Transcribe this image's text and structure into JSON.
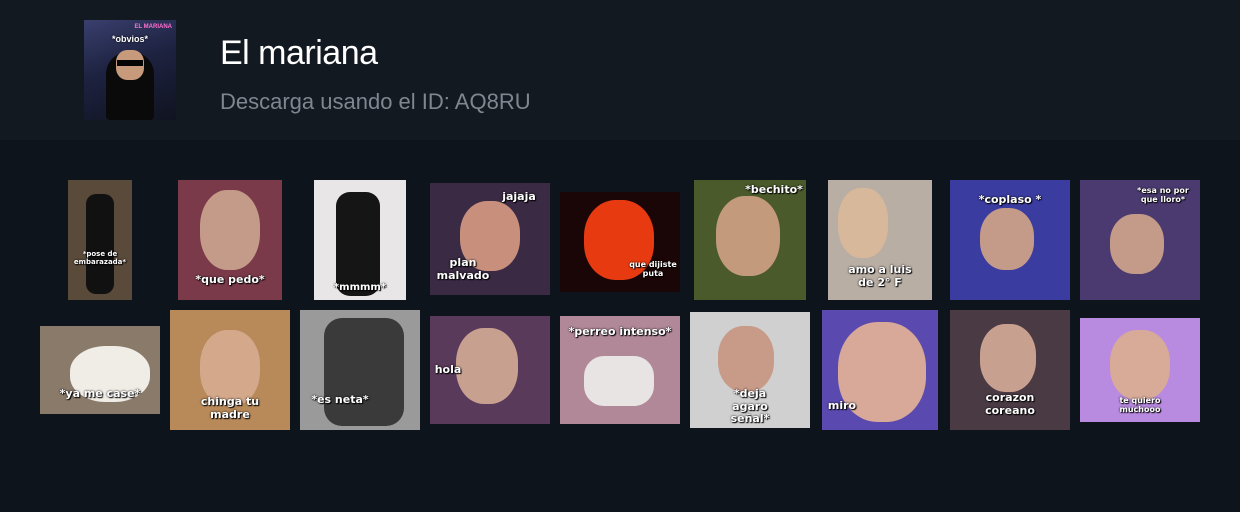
{
  "pack": {
    "title": "El mariana",
    "subtitle": "Descarga usando el ID: AQ8RU",
    "cover_caption": "*obvios*",
    "cover_neon": "EL MARIANA"
  },
  "stickers": [
    {
      "caption": "*pose de embarazada*",
      "bg": "#5a4a3a"
    },
    {
      "caption": "*que pedo*",
      "bg": "#7a3a4a"
    },
    {
      "caption": "*mmmm*",
      "bg": "#e8e6e6"
    },
    {
      "caption": "jajaja",
      "caption2": "plan malvado",
      "bg": "#3a2a44"
    },
    {
      "caption": "que dijiste puta",
      "bg": "#1a0606"
    },
    {
      "caption": "*bechito*",
      "bg": "#4a5a2a"
    },
    {
      "caption": "amo a luis de 2° F",
      "bg": "#b8aea4"
    },
    {
      "caption": "*coplaso *",
      "bg": "#3a3ca0"
    },
    {
      "caption": "*esa no por que lloro*",
      "bg": "#4a3a70"
    },
    {
      "caption": "*ya me case*",
      "bg": "#8a7a6a"
    },
    {
      "caption": "chinga tu madre",
      "bg": "#b88a5a"
    },
    {
      "caption": "*es neta*",
      "bg": "#9a9a9a"
    },
    {
      "caption": "hola",
      "bg": "#5a3a5a"
    },
    {
      "caption": "*perreo intenso*",
      "bg": "#b08898"
    },
    {
      "caption": "*deja agaro señal*",
      "bg": "#d0d0d0"
    },
    {
      "caption": "miro",
      "bg": "#5a4ab0"
    },
    {
      "caption": "corazon coreano",
      "bg": "#4a3a44"
    },
    {
      "caption": "te quiero muchooo",
      "bg": "#b88ae0"
    }
  ]
}
